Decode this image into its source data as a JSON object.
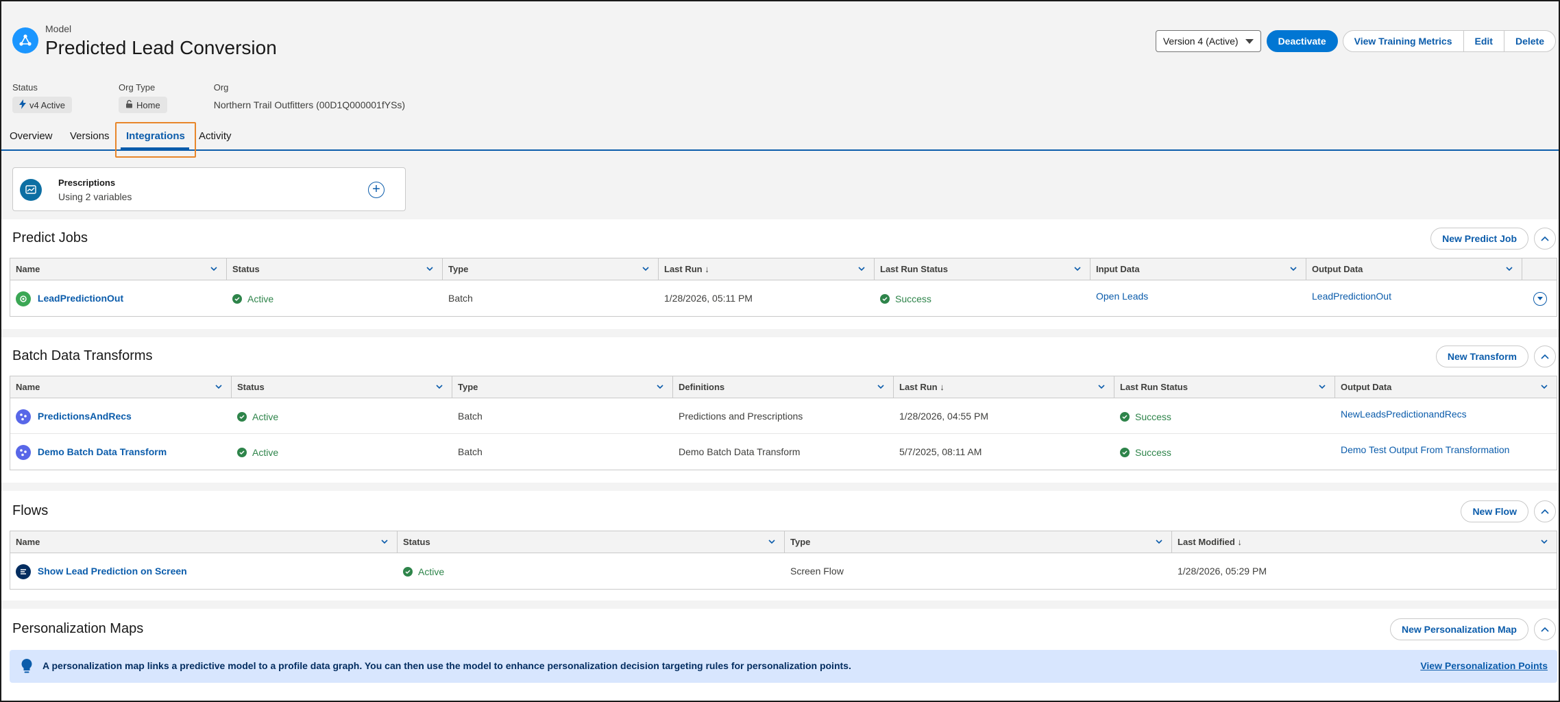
{
  "header": {
    "eyebrow": "Model",
    "title": "Predicted Lead Conversion",
    "version_select": "Version 4 (Active)",
    "deactivate_label": "Deactivate",
    "view_metrics_label": "View Training Metrics",
    "edit_label": "Edit",
    "delete_label": "Delete",
    "fields": {
      "status_label": "Status",
      "status_value": "v4 Active",
      "org_type_label": "Org Type",
      "org_type_value": "Home",
      "org_label": "Org",
      "org_value": "Northern Trail Outfitters (00D1Q000001fYSs)"
    }
  },
  "tabs": [
    "Overview",
    "Versions",
    "Integrations",
    "Activity"
  ],
  "active_tab": "Integrations",
  "prescriptions": {
    "title": "Prescriptions",
    "subtitle": "Using 2 variables"
  },
  "predict_jobs": {
    "title": "Predict Jobs",
    "new_label": "New Predict Job",
    "columns": [
      "Name",
      "Status",
      "Type",
      "Last Run ↓",
      "Last Run Status",
      "Input Data",
      "Output Data"
    ],
    "rows": [
      {
        "name": "LeadPredictionOut",
        "status": "Active",
        "type": "Batch",
        "last_run": "1/28/2026, 05:11 PM",
        "last_run_status": "Success",
        "input": "Open Leads",
        "output": "LeadPredictionOut"
      }
    ]
  },
  "batch_transforms": {
    "title": "Batch Data Transforms",
    "new_label": "New Transform",
    "columns": [
      "Name",
      "Status",
      "Type",
      "Definitions",
      "Last Run ↓",
      "Last Run Status",
      "Output Data"
    ],
    "rows": [
      {
        "name": "PredictionsAndRecs",
        "status": "Active",
        "type": "Batch",
        "definitions": "Predictions and Prescriptions",
        "last_run": "1/28/2026, 04:55 PM",
        "last_run_status": "Success",
        "output": "NewLeadsPredictionandRecs"
      },
      {
        "name": "Demo Batch Data Transform",
        "status": "Active",
        "type": "Batch",
        "definitions": "Demo Batch Data Transform",
        "last_run": "5/7/2025, 08:11 AM",
        "last_run_status": "Success",
        "output": "Demo Test Output From Transformation"
      }
    ]
  },
  "flows": {
    "title": "Flows",
    "new_label": "New Flow",
    "columns": [
      "Name",
      "Status",
      "Type",
      "Last Modified ↓"
    ],
    "rows": [
      {
        "name": "Show Lead Prediction on Screen",
        "status": "Active",
        "type": "Screen Flow",
        "last_modified": "1/28/2026, 05:29 PM"
      }
    ]
  },
  "personalization": {
    "title": "Personalization Maps",
    "new_label": "New Personalization Map",
    "info": "A personalization map links a predictive model to a profile data graph. You can then use the model to enhance personalization decision targeting rules for personalization points.",
    "link": "View Personalization Points"
  },
  "colors": {
    "brand": "#0176d3",
    "link": "#0b5cab",
    "success": "#2e844a",
    "tab_highlight": "#e8862a",
    "info_bg": "#d8e6fe"
  },
  "icons": [
    "model-icon",
    "bolt-icon",
    "lock-icon",
    "chevron-down-icon",
    "add-icon",
    "collapse-icon",
    "check-circle-icon",
    "flow-icon",
    "transform-icon",
    "lightbulb-icon"
  ]
}
